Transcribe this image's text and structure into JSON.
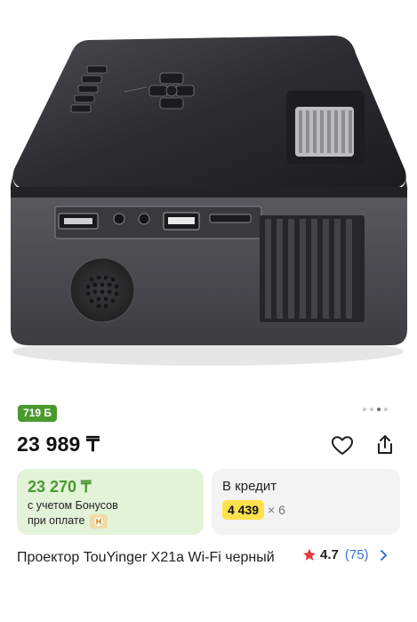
{
  "gallery": {
    "image_name": "projector-product-photo",
    "dots": [
      false,
      false,
      true,
      false
    ]
  },
  "bonus_badge": {
    "label": "719 Б"
  },
  "price": {
    "current": "23 989 ₸"
  },
  "bonus_card": {
    "price": "23 270 ₸",
    "line1": "с учетом Бонусов",
    "line2": "при оплате"
  },
  "credit_card": {
    "title": "В кредит",
    "amount": "4 439",
    "times": "× 6"
  },
  "product": {
    "title": "Проектор TouYinger X21a Wi-Fi черный"
  },
  "rating": {
    "value": "4.7",
    "count": "(75)"
  },
  "colors": {
    "accent_green": "#4a9a2f",
    "bonus_card_bg": "#e2f3d8",
    "credit_highlight": "#ffe14d",
    "star_red": "#d9413a",
    "link_blue": "#3b6fd4"
  },
  "icons": [
    "heart-icon",
    "share-icon",
    "star-icon",
    "chevron-right-icon",
    "coin-icon"
  ]
}
